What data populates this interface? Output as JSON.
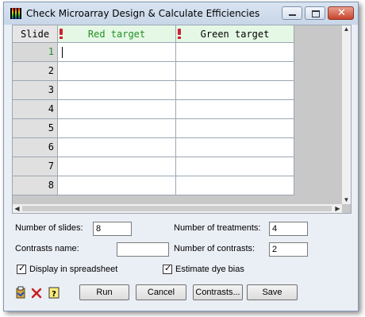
{
  "window": {
    "title": "Check Microarray Design & Calculate Efficiencies"
  },
  "grid": {
    "columns": [
      "Slide",
      "Red target",
      "Green target"
    ],
    "rows": [
      "1",
      "2",
      "3",
      "4",
      "5",
      "6",
      "7",
      "8"
    ],
    "header_colors": {
      "red_target_text": "#238e23",
      "header_bg": "#e5f8e5",
      "mark": "#d0222e"
    }
  },
  "form": {
    "num_slides_label": "Number of slides:",
    "num_slides_value": "8",
    "num_treatments_label": "Number of treatments:",
    "num_treatments_value": "4",
    "contrasts_name_label": "Contrasts name:",
    "contrasts_name_value": "",
    "num_contrasts_label": "Number of contrasts:",
    "num_contrasts_value": "2",
    "display_spreadsheet_label": "Display in spreadsheet",
    "display_spreadsheet_checked": true,
    "estimate_dye_bias_label": "Estimate dye bias",
    "estimate_dye_bias_checked": true
  },
  "buttons": {
    "run": "Run",
    "cancel": "Cancel",
    "contrasts": "Contrasts...",
    "save": "Save"
  },
  "toolbar_icons": [
    "clipboard-icon",
    "clear-icon",
    "help-icon"
  ]
}
